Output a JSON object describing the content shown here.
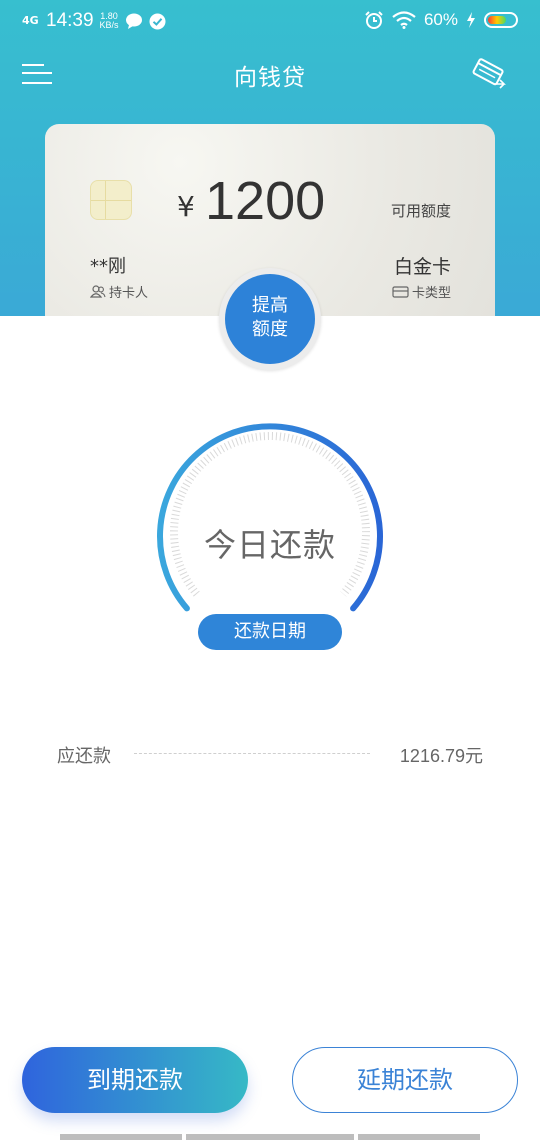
{
  "status_bar": {
    "network": "4G",
    "time": "14:39",
    "speed_value": "1.80",
    "speed_unit": "KB/s",
    "battery": "60%"
  },
  "header": {
    "title": "向钱贷"
  },
  "card": {
    "currency": "¥",
    "amount": "1200",
    "available_label": "可用额度",
    "holder_name": "**刚",
    "holder_label": "持卡人",
    "card_type": "白金卡",
    "card_type_label": "卡类型"
  },
  "raise_button": {
    "line1": "提高",
    "line2": "额度"
  },
  "gauge": {
    "center_text": "今日还款",
    "pill_label": "还款日期"
  },
  "repayment": {
    "label": "应还款",
    "value": "1216.79元"
  },
  "actions": {
    "due_label": "到期还款",
    "delay_label": "延期还款"
  },
  "colors": {
    "header_start": "#37bfcf",
    "header_end": "#3aa9d6",
    "accent_blue": "#2f85d8"
  }
}
